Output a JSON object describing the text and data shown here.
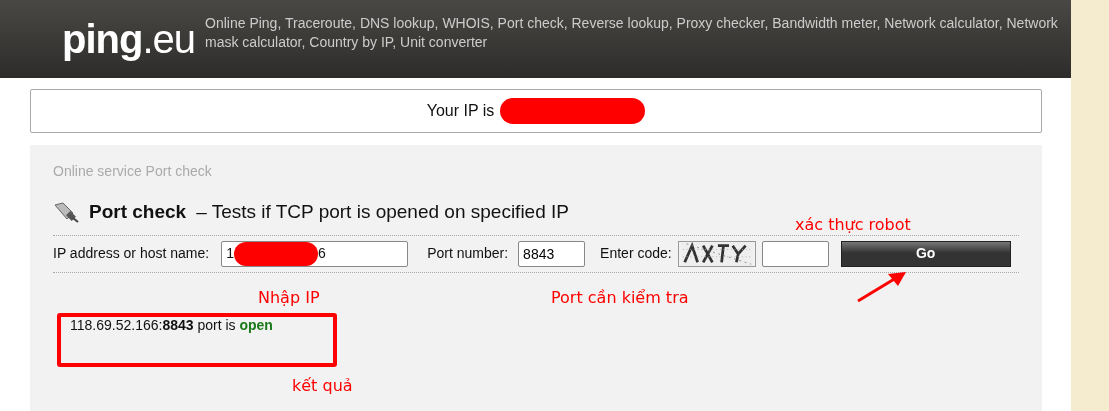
{
  "header": {
    "logo": "**ping**.eu",
    "services": "Online Ping, Traceroute, DNS lookup, WHOIS, Port check, Reverse lookup, Proxy checker, Bandwidth meter, Network calculator, Network mask calculator, Country by IP, Unit converter"
  },
  "your_ip": {
    "label": "Your IP is",
    "redacted": true
  },
  "breadcrumb": "Online service Port check",
  "heading": {
    "title": "Port check",
    "subtitle": "– Tests if TCP port is opened on specified IP"
  },
  "form": {
    "ip_label": "IP address or host name:",
    "ip_value_start": "1",
    "ip_value_end": "6",
    "ip_redacted": true,
    "port_label": "Port number:",
    "port_value": "8843",
    "code_label": "Enter code:",
    "button": "Go"
  },
  "result": "118.69.52.166:**8843** port is **open**",
  "annotations": [
    {
      "kind": "label",
      "text": "xác thực robot"
    },
    {
      "kind": "label",
      "text": "Nhập IP"
    },
    {
      "kind": "label",
      "text": "Port cần kiểm tra"
    },
    {
      "kind": "label",
      "text": "kết quả"
    },
    {
      "kind": "box"
    },
    {
      "kind": "arrow"
    }
  ]
}
